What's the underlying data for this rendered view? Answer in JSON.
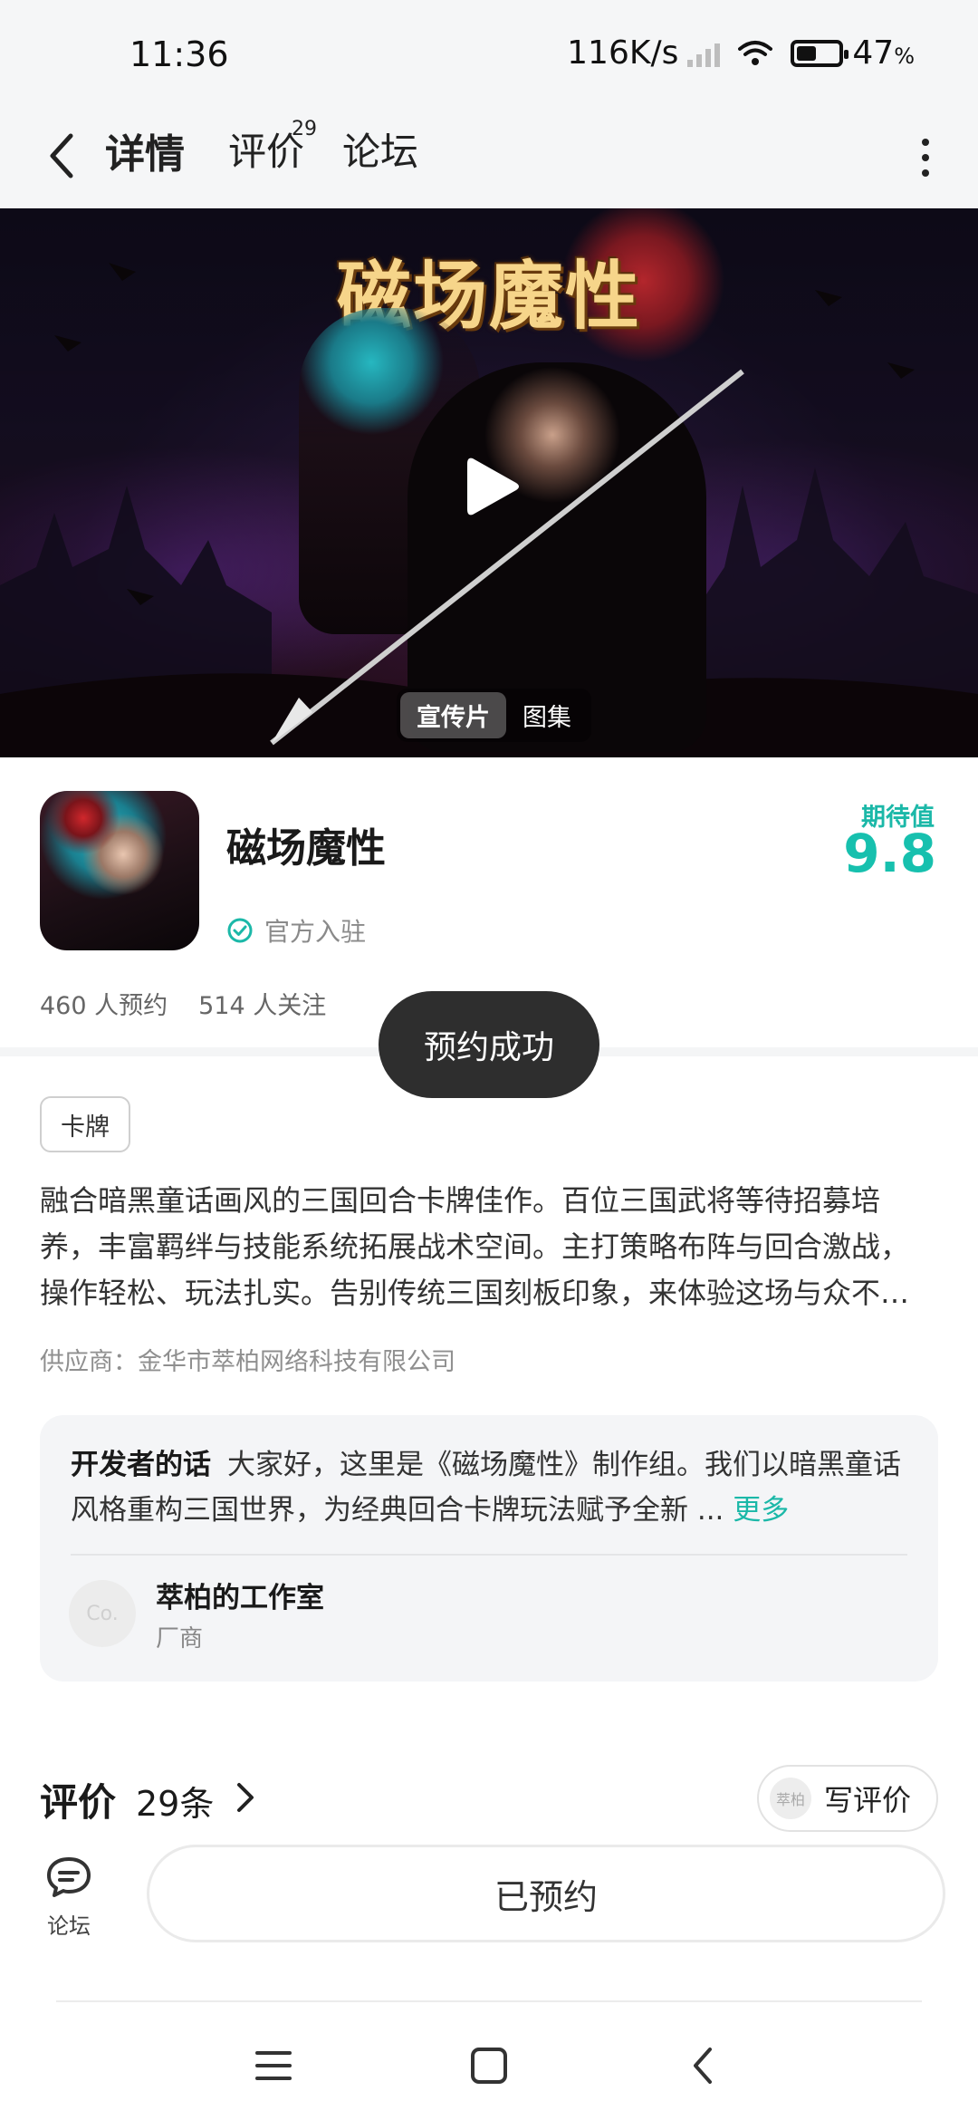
{
  "status_bar": {
    "time": "11:36",
    "net_speed": "116K/s",
    "battery_text": "47",
    "battery_unit": "%",
    "battery_level": 0.47
  },
  "nav": {
    "tabs": [
      {
        "label": "详情",
        "active": true
      },
      {
        "label": "评价",
        "badge": "29"
      },
      {
        "label": "论坛"
      }
    ]
  },
  "hero": {
    "title_art": "磁场魔性",
    "tabs": [
      "宣传片",
      "图集"
    ]
  },
  "app": {
    "name": "磁场魔性",
    "official_label": "官方入驻",
    "expect_label": "期待值",
    "expect_value": "9.8",
    "reservations": "460 人预约",
    "followers": "514 人关注"
  },
  "toast": "预约成功",
  "tag": "卡牌",
  "description": {
    "line1": "融合暗黑童话画风的三国回合卡牌佳作。百位三国武将等待招募培",
    "line2": "养，丰富羁绊与技能系统拓展战术空间。主打策略布阵与回合激战，",
    "line3": "操作轻松、玩法扎实。告别传统三国刻板印象，来体验这场与众不…"
  },
  "supplier": "供应商：金华市萃柏网络科技有限公司",
  "developer": {
    "title": "开发者的话",
    "text": "大家好，这里是《磁场魔性》制作组。我们以暗黑童话风格重构三国世界，为经典回合卡牌玩法赋予全新 ...",
    "more": "更多",
    "avatar_text": "Co.",
    "name": "萃柏的工作室",
    "role": "厂商"
  },
  "reviews": {
    "title": "评价",
    "count": "29条",
    "write_label": "写评价",
    "write_avatar_text": "萃柏"
  },
  "bottom": {
    "forum_label": "论坛",
    "reserve_label": "已预约"
  },
  "icons": {
    "back": "chevron-left-icon",
    "more": "more-vertical-icon",
    "play": "play-icon",
    "verified": "check-circle-icon",
    "forum": "chat-bubble-icon"
  },
  "colors": {
    "accent": "#17c0ae",
    "toast_bg": "#2e2e2e"
  }
}
